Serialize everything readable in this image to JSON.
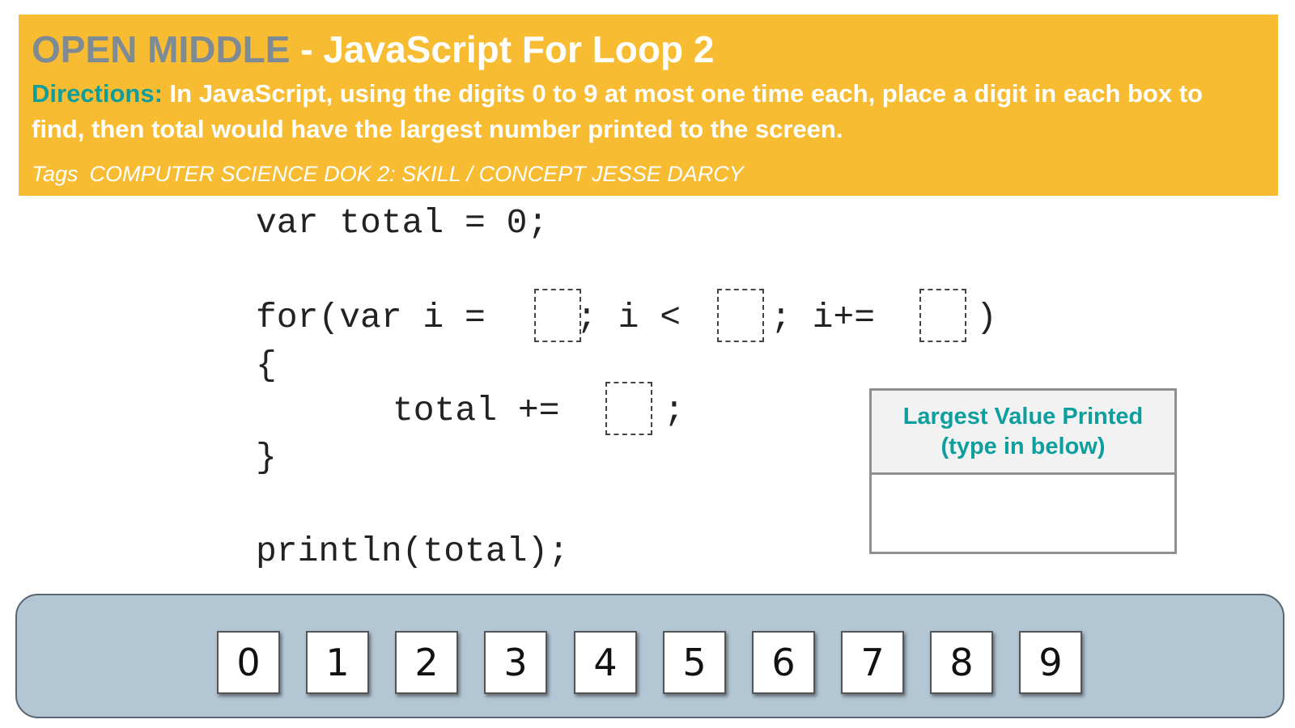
{
  "header": {
    "title_prefix": "OPEN MIDDLE",
    "title_suffix": " - JavaScript For Loop 2",
    "directions_label": "Directions:",
    "directions_text": " In JavaScript, using the digits 0 to 9 at most one time each, place a digit in each box to find, then total would have the largest number printed to the screen.",
    "tags_label": "Tags",
    "tags_text": "COMPUTER SCIENCE DOK 2: SKILL / CONCEPT JESSE DARCY",
    "colors": {
      "background": "#F7BC31",
      "title_prefix": "#7E8B95",
      "directions_label": "#0E9E9E",
      "text": "#FFFFFF"
    }
  },
  "code": {
    "line1": "var total = 0;",
    "for_start": "for(var i =",
    "for_cond": "; i <",
    "for_incr": "; i+=",
    "for_close": ")",
    "brace_open": "{",
    "total_stmt": "total +=",
    "semicolon": ";",
    "brace_close": "}",
    "print_stmt": "println(total);"
  },
  "answer": {
    "header_line1": "Largest Value Printed",
    "header_line2": "(type in below)",
    "value": ""
  },
  "tiles": [
    "0",
    "1",
    "2",
    "3",
    "4",
    "5",
    "6",
    "7",
    "8",
    "9"
  ]
}
